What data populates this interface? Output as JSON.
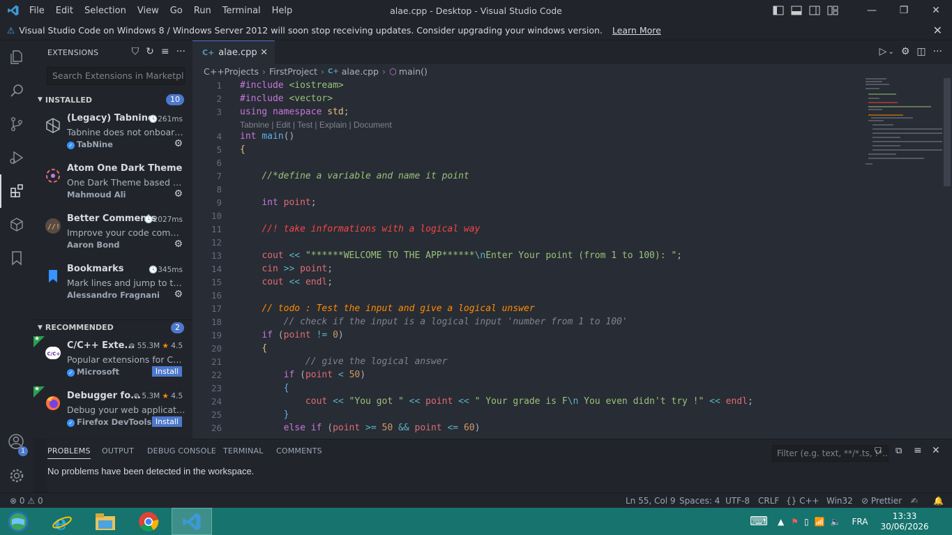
{
  "titlebar": {
    "menu": [
      "File",
      "Edit",
      "Selection",
      "View",
      "Go",
      "Run",
      "Terminal",
      "Help"
    ],
    "title": "alae.cpp - Desktop - Visual Studio Code"
  },
  "banner": {
    "message": "Visual Studio Code on Windows 8 / Windows Server 2012 will soon stop receiving updates. Consider upgrading your windows version.",
    "link": "Learn More"
  },
  "sidebar": {
    "title": "EXTENSIONS",
    "search_placeholder": "Search Extensions in Marketpl...",
    "installed": {
      "label": "INSTALLED",
      "count": "10",
      "items": [
        {
          "name": "(Legacy) Tabnine",
          "time": "261ms",
          "desc": "Tabnine does not onboard ...",
          "publisher": "TabNine"
        },
        {
          "name": "Atom One Dark Theme",
          "time": "",
          "desc": "One Dark Theme based on ...",
          "publisher": "Mahmoud Ali"
        },
        {
          "name": "Better Comments",
          "time": "2027ms",
          "desc": "Improve your code comme...",
          "publisher": "Aaron Bond"
        },
        {
          "name": "Bookmarks",
          "time": "345ms",
          "desc": "Mark lines and jump to them",
          "publisher": "Alessandro Fragnani"
        }
      ]
    },
    "recommended": {
      "label": "RECOMMENDED",
      "count": "2",
      "items": [
        {
          "name": "C/C++ Exte...",
          "downloads": "55.3M",
          "rating": "4.5",
          "desc": "Popular extensions for C++...",
          "publisher": "Microsoft",
          "action": "Install"
        },
        {
          "name": "Debugger fo...",
          "downloads": "5.3M",
          "rating": "4.5",
          "desc": "Debug your web applicatio...",
          "publisher": "Firefox DevTools",
          "action": "Install"
        }
      ]
    }
  },
  "editor": {
    "tab": "alae.cpp",
    "breadcrumb": [
      "C++Projects",
      "FirstProject",
      "alae.cpp",
      "main()"
    ],
    "codelens": "Tabnine | Edit | Test | Explain | Document",
    "line_numbers": [
      "1",
      "2",
      "3",
      "4",
      "5",
      "6",
      "7",
      "8",
      "9",
      "10",
      "11",
      "12",
      "13",
      "14",
      "15",
      "16",
      "17",
      "18",
      "19",
      "20",
      "21",
      "22",
      "23",
      "24",
      "25",
      "26"
    ]
  },
  "panel": {
    "tabs": [
      "PROBLEMS",
      "OUTPUT",
      "DEBUG CONSOLE",
      "TERMINAL",
      "COMMENTS"
    ],
    "filter_placeholder": "Filter (e.g. text, **/*.ts, !*...",
    "message": "No problems have been detected in the workspace."
  },
  "statusbar": {
    "errors": "0",
    "warnings": "0",
    "position": "Ln 55, Col 9",
    "spaces": "Spaces: 4",
    "encoding": "UTF-8",
    "eol": "CRLF",
    "language": "C++",
    "platform": "Win32",
    "formatter": "Prettier"
  },
  "accounts_badge": "1",
  "taskbar": {
    "lang": "FRA",
    "time": "13:33",
    "date": "30/06/2026"
  }
}
